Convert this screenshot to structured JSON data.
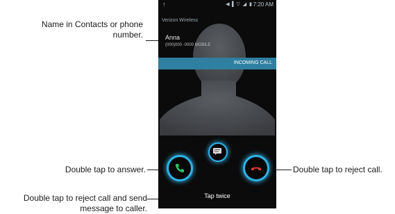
{
  "callouts": {
    "name": "Name in Contacts or phone number.",
    "answer": "Double tap to answer.",
    "reject_message": "Double tap to reject call and send message to caller.",
    "reject": "Double tap to reject call."
  },
  "status_bar": {
    "time": "7:20 AM"
  },
  "phone": {
    "carrier": "Verizon Wireless",
    "caller_name": "Anna",
    "caller_number": "(000)000 -0000 MOBILE",
    "incoming_label": "INCOMING CALL",
    "hint": "Tap twice"
  },
  "icons": {
    "answer": "phone-answer-icon",
    "reject": "phone-hangup-icon",
    "message": "message-icon"
  },
  "colors": {
    "accent": "#2fb3e8",
    "answer": "#27c266",
    "reject": "#e23a3a",
    "banner": "#2f7fa0"
  }
}
